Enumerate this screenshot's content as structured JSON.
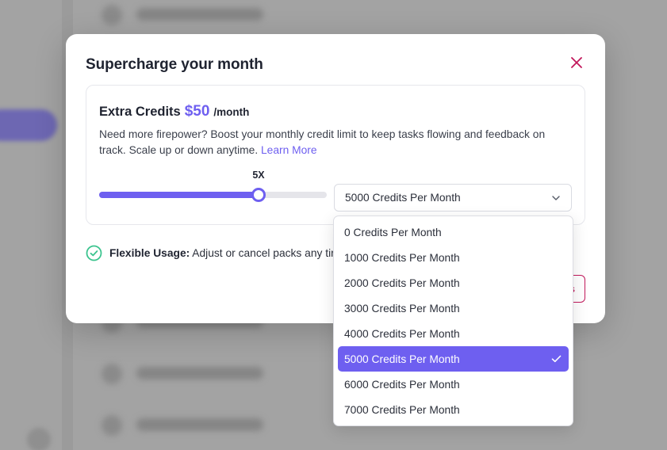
{
  "modal": {
    "title": "Supercharge your month",
    "close_icon": "close-icon"
  },
  "card": {
    "name": "Extra Credits",
    "price": "$50",
    "period": "/month",
    "description": "Need more firepower? Boost your monthly credit limit to keep tasks flowing and feedback on track. Scale up or down anytime.",
    "learn_more": "Learn More"
  },
  "slider": {
    "label": "5X",
    "value_fraction": 0.7
  },
  "select": {
    "value": "5000 Credits Per Month",
    "options": [
      "0 Credits Per Month",
      "1000 Credits Per Month",
      "2000 Credits Per Month",
      "3000 Credits Per Month",
      "4000 Credits Per Month",
      "5000 Credits Per Month",
      "6000 Credits Per Month",
      "7000 Credits Per Month"
    ],
    "selected_index": 5
  },
  "feature": {
    "title": "Flexible Usage:",
    "text": "Adjust or cancel packs any tir"
  },
  "colors": {
    "accent": "#6e5ff0",
    "close": "#c2185b",
    "check_green": "#3cc48f"
  }
}
